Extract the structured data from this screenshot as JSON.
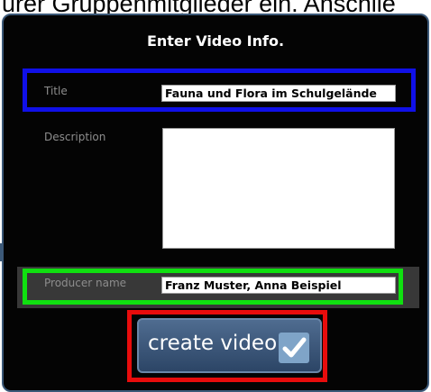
{
  "background_text": "urer Gruppenmitglieder ein. Anschlie",
  "dialog": {
    "title": "Enter Video Info.",
    "fields": {
      "title_label": "Title",
      "title_value": "Fauna und Flora im Schulgelände",
      "description_label": "Description",
      "description_value": "",
      "producer_label": "Producer name",
      "producer_value": "Franz Muster, Anna Beispiel"
    },
    "create_button_label": "create video",
    "icons": {
      "create": "checkmark-icon"
    }
  },
  "colors": {
    "dialog_bg": "#040404",
    "dialog_border": "#3c5978",
    "highlight_title": "#1010e8",
    "highlight_producer": "#10e010",
    "highlight_button": "#e80c0c",
    "button": "#3f5a7d",
    "check": "#7fa4c8"
  }
}
